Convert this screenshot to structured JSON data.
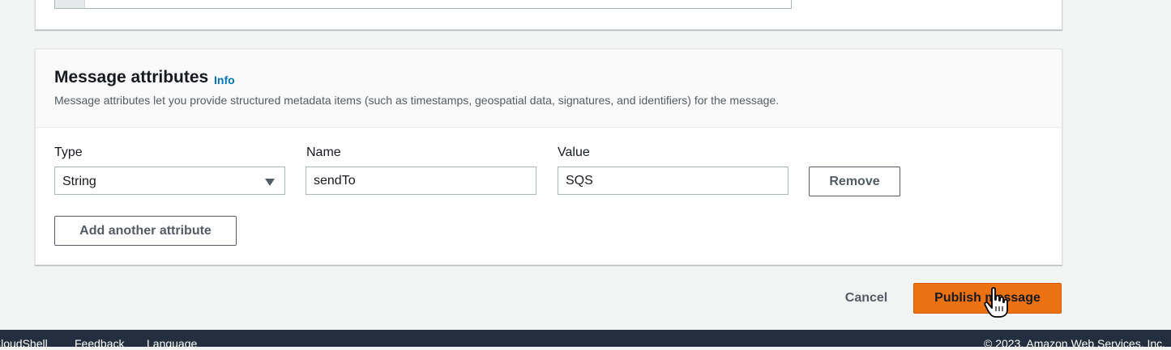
{
  "message_attributes": {
    "title": "Message attributes",
    "info_link": "Info",
    "description": "Message attributes let you provide structured metadata items (such as timestamps, geospatial data, signatures, and identifiers) for the message.",
    "type_label": "Type",
    "name_label": "Name",
    "value_label": "Value",
    "attribute": {
      "type": "String",
      "name": "sendTo",
      "value": "SQS"
    },
    "remove_button": "Remove",
    "add_button": "Add another attribute"
  },
  "actions": {
    "cancel": "Cancel",
    "publish": "Publish message"
  },
  "footer": {
    "cloudshell": "CloudShell",
    "feedback": "Feedback",
    "language": "Language",
    "copyright": "© 2023, Amazon Web Services, Inc."
  },
  "colors": {
    "primary_button": "#ec7211",
    "info_link": "#0073bb",
    "footer_bg": "#232f3e"
  },
  "icons": {
    "select_caret": "caret-down-icon",
    "cursor": "hand-cursor-icon"
  }
}
